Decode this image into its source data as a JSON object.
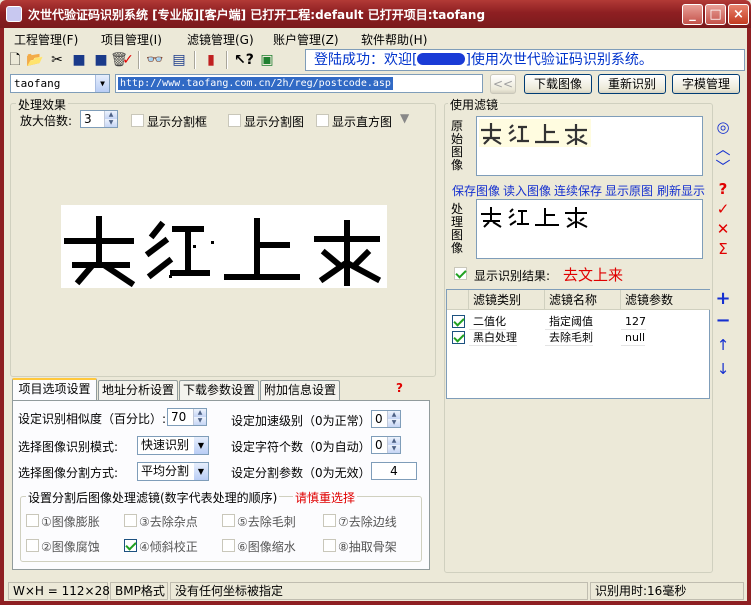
{
  "window": {
    "title": "次世代验证码识别系统 [专业版][客户端] 已打开工程:default 已打开项目:taofang",
    "btn_min": "_",
    "btn_max": "□",
    "btn_close": "×"
  },
  "menu": [
    "工程管理(F)",
    "项目管理(I)",
    "滤镜管理(G)",
    "账户管理(Z)",
    "软件帮助(H)"
  ],
  "banner": {
    "pre": "登陆成功：欢迎[",
    "post": "]使用次世代验证码识别系统。"
  },
  "project_combo": "taofang",
  "url": "http://www.taofang.com.cn/2h/reg/postcode.asp",
  "buttons": {
    "back": "<<",
    "download": "下载图像",
    "reidentify": "重新识别",
    "font_manage": "字模管理"
  },
  "effect": {
    "group": "处理效果",
    "zoom_label": "放大倍数:",
    "zoom_value": "3",
    "show_seg_box": "显示分割框",
    "show_seg_img": "显示分割图",
    "show_hist": "显示直方图"
  },
  "tabs": [
    "项目选项设置",
    "地址分析设置",
    "下载参数设置",
    "附加信息设置"
  ],
  "options": {
    "similarity_label": "设定识别相似度（百分比）:",
    "similarity": "70",
    "mode_label": "选择图像识别模式:",
    "mode": "快速识别",
    "split_label": "选择图像分割方式:",
    "split": "平均分割",
    "accel_label": "设定加速级别（0为正常）:",
    "accel": "0",
    "charcount_label": "设定字符个数（0为自动）:",
    "charcount": "0",
    "splitparam_label": "设定分割参数（0为无效）:",
    "splitparam": "4",
    "filter_group": "设置分割后图像处理滤镜(数字代表处理的顺序)",
    "filter_warn": "请慎重选择",
    "filters": [
      "①图像膨胀",
      "③去除杂点",
      "⑤去除毛刺",
      "⑦去除边线",
      "②图像腐蚀",
      "④倾斜校正",
      "⑥图像缩水",
      "⑧抽取骨架"
    ]
  },
  "filters": {
    "group": "使用滤镜",
    "original_label": "原始图像",
    "processed_label": "处理图像",
    "links": [
      "保存图像",
      "读入图像",
      "连续保存",
      "显示原图",
      "刷新显示"
    ],
    "show_result_label": "显示识别结果:",
    "result": "去文上来",
    "grid_headers": [
      "滤镜类别",
      "滤镜名称",
      "滤镜参数"
    ],
    "rows": [
      {
        "type": "二值化",
        "name": "指定阈值",
        "param": "127"
      },
      {
        "type": "黑白处理",
        "name": "去除毛刺",
        "param": "null"
      }
    ]
  },
  "captcha_text": "去红上来",
  "status": {
    "size": "W×H = 112×28",
    "format": "BMP格式",
    "coord": "没有任何坐标被指定",
    "time": "识别用时:16毫秒"
  },
  "colors": {
    "title": "#8e1f22",
    "accent_red": "#e00000",
    "link_blue": "#1530d0"
  }
}
